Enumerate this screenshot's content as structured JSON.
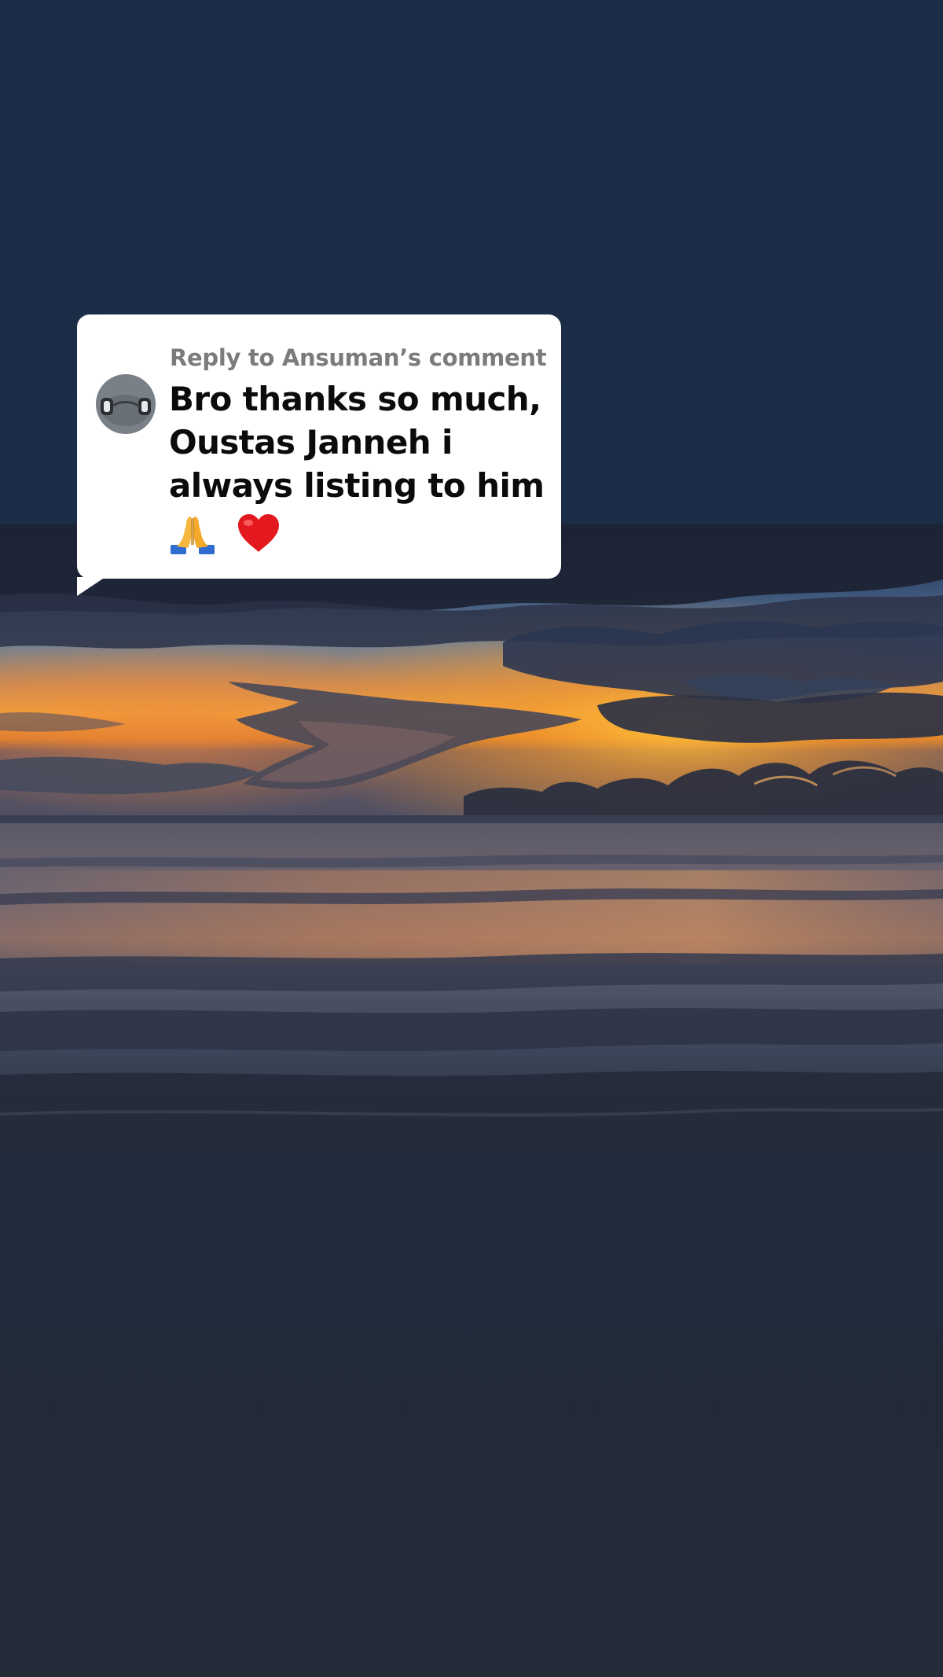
{
  "comment": {
    "reply_label": "Reply to Ansuman’s comment",
    "lines": [
      "Bro thanks so much,",
      "Oustas Janneh i",
      "always listing to him"
    ],
    "emojis": [
      "pray-emoji",
      "red-heart-emoji"
    ]
  },
  "video": {
    "scene": "sunset-over-ocean",
    "colors": {
      "sky_top": "#2a3a55",
      "horizon_glow": "#f39a2a",
      "sea": "#3a4256"
    }
  },
  "colors": {
    "background_top": "#1b2c47",
    "background_bottom": "#242a38",
    "bubble": "#ffffff",
    "reply_label": "#7b7b7b",
    "comment_text": "#0b0b0b"
  }
}
